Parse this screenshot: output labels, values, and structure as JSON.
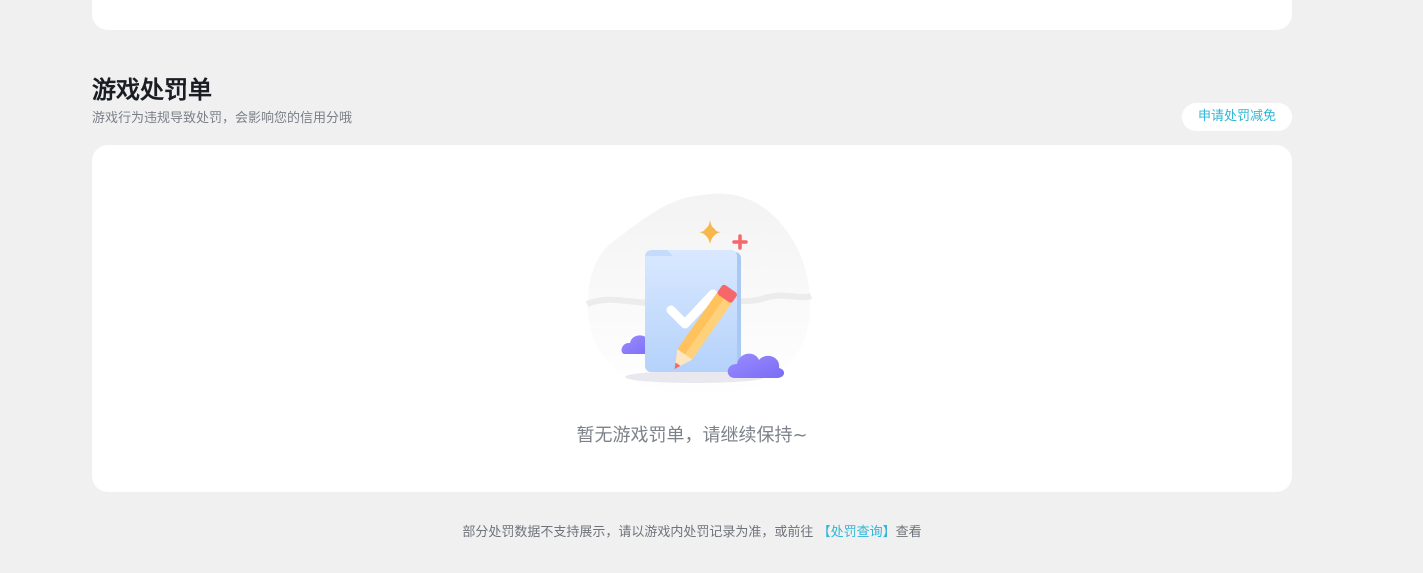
{
  "section": {
    "title": "游戏处罚单",
    "subtitle": "游戏行为违规导致处罚，会影响您的信用分哦",
    "appeal_button": "申请处罚减免"
  },
  "empty_state": {
    "message": "暂无游戏罚单，请继续保持~",
    "illustration_icon": "checklist-pencil-icon"
  },
  "footer": {
    "note_before": "部分处罚数据不支持展示，请以游戏内处罚记录为准，或前往",
    "link_text": "【处罚查询】",
    "note_after": "查看"
  },
  "colors": {
    "background": "#f0f0f0",
    "card": "#ffffff",
    "accent": "#2fb6d8",
    "title": "#1a1d24"
  }
}
